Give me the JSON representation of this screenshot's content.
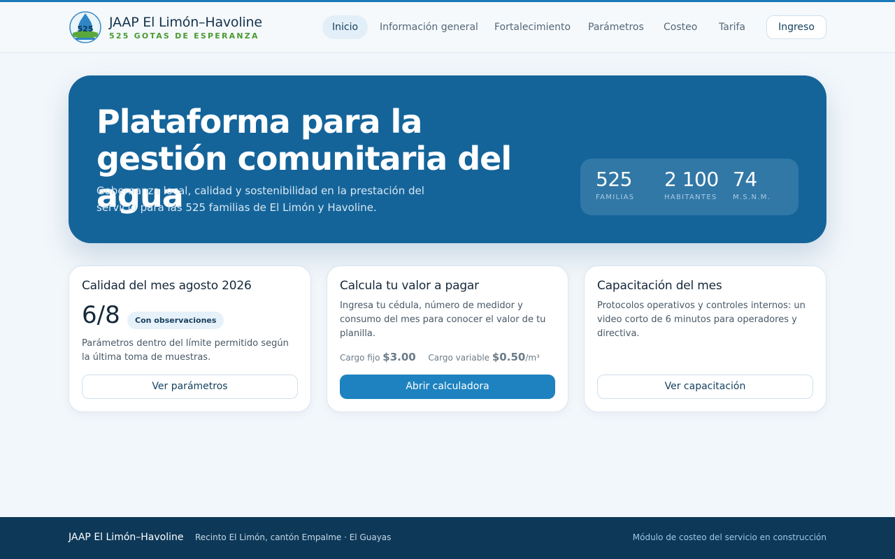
{
  "header": {
    "brand_name": "JAAP El Limón–Havoline",
    "brand_tagline": "525 GOTAS DE ESPERANZA",
    "logo_text": "525",
    "nav": [
      {
        "label": "Inicio",
        "active": true
      },
      {
        "label": "Información general"
      },
      {
        "label": "Fortalecimiento"
      },
      {
        "label": "Parámetros"
      },
      {
        "label": "Costeo"
      },
      {
        "label": "Tarifa"
      }
    ],
    "login_label": "Ingreso"
  },
  "hero": {
    "title": "Plataforma para la gestión comunitaria del agua",
    "subtitle": "Gobernanza local, calidad y sostenibilidad en la prestación del servicio para las 525 familias de El Limón y Havoline.",
    "stats": [
      {
        "value": "525",
        "label": "FAMILIAS"
      },
      {
        "value": "2 100",
        "label": "HABITANTES"
      },
      {
        "value": "74",
        "label": "M.S.N.M."
      }
    ]
  },
  "cards": {
    "quality": {
      "title": "Calidad del mes agosto 2026",
      "score": "6/8",
      "badge": "Con observaciones",
      "text": "Parámetros dentro del límite permitido según la última toma de muestras.",
      "button": "Ver parámetros"
    },
    "calculator": {
      "title": "Calcula tu valor a pagar",
      "text": "Ingresa tu cédula, número de medidor y consumo del mes para conocer el valor de tu planilla.",
      "fixed_label": "Cargo fijo",
      "fixed_value": "$3.00",
      "variable_label": "Cargo variable",
      "variable_value": "$0.50",
      "variable_unit": "/m³",
      "button": "Abrir calculadora"
    },
    "training": {
      "title": "Capacitación del mes",
      "text": "Protocolos operativos y controles internos: un video corto de 6 minutos para operadores y directiva.",
      "button": "Ver capacitación"
    }
  },
  "footer": {
    "brand": "JAAP El Limón–Havoline",
    "location": "Recinto El Limón, cantón Empalme · El Guayas",
    "note": "Módulo de costeo del servicio en construcción"
  },
  "colors": {
    "accent": "#1b7ab8",
    "hero_bg": "#14649a",
    "footer_bg": "#0d3858",
    "tagline_green": "#4a9a32"
  }
}
